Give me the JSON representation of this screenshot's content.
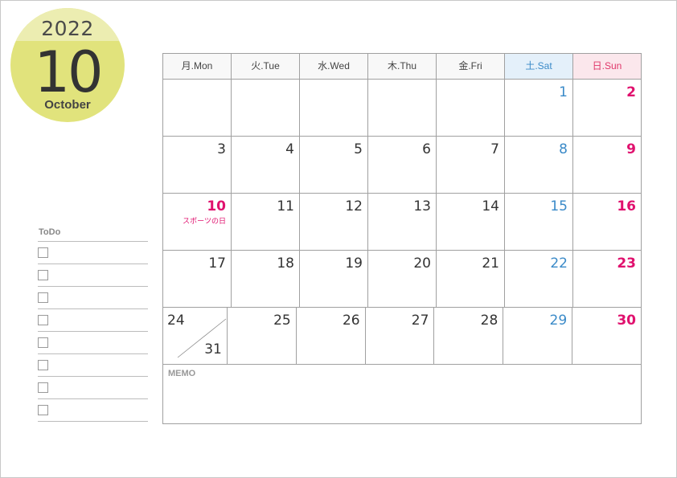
{
  "badge": {
    "year": "2022",
    "month_number": "10",
    "month_name": "October"
  },
  "todo": {
    "title": "ToDo",
    "items": [
      "",
      "",
      "",
      "",
      "",
      "",
      "",
      ""
    ]
  },
  "calendar": {
    "headers": [
      "月.Mon",
      "火.Tue",
      "水.Wed",
      "木.Thu",
      "金.Fri",
      "土.Sat",
      "日.Sun"
    ],
    "weeks": [
      [
        "",
        "",
        "",
        "",
        "",
        "1",
        "2"
      ],
      [
        "3",
        "4",
        "5",
        "6",
        "7",
        "8",
        "9"
      ],
      [
        "10",
        "11",
        "12",
        "13",
        "14",
        "15",
        "16"
      ],
      [
        "17",
        "18",
        "19",
        "20",
        "21",
        "22",
        "23"
      ],
      [
        "24",
        "25",
        "26",
        "27",
        "28",
        "29",
        "30"
      ]
    ],
    "split_day": {
      "top": "24",
      "bottom": "31"
    },
    "holidays": {
      "10": "スポーツの日"
    },
    "colors": {
      "saturday": "#3a8ac8",
      "sunday": "#e0116e",
      "badge": "#e1e37c"
    }
  },
  "memo": {
    "label": "MEMO"
  }
}
